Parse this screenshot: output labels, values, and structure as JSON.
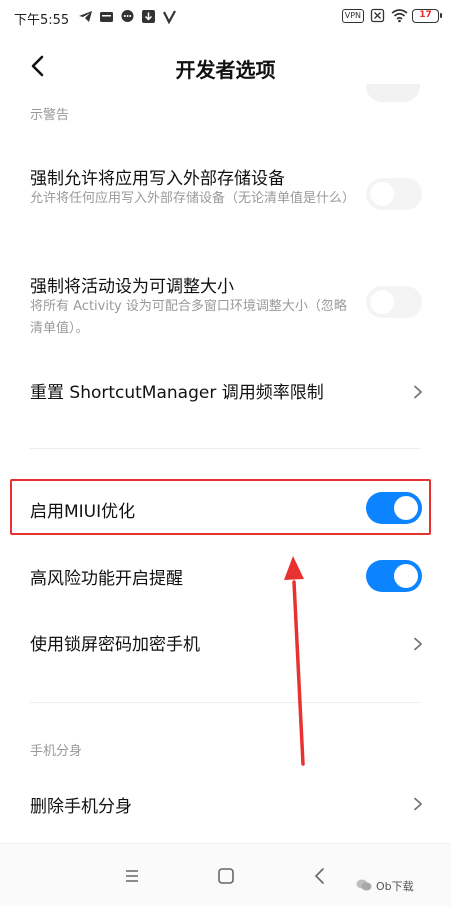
{
  "status_bar": {
    "time": "下午5:55",
    "vpn_label": "VPN",
    "battery": "17",
    "left_icons": [
      "telegram-icon",
      "notification-box-icon",
      "chat-icon",
      "download-icon",
      "v-app-icon"
    ],
    "right_icons": [
      "vpn-icon",
      "sim-icon",
      "wifi-icon",
      "battery-icon"
    ]
  },
  "header": {
    "title": "开发者选项",
    "back_icon": "back-arrow-icon"
  },
  "list": {
    "cut_text": "示警告",
    "items": [
      {
        "title": "强制允许将应用写入外部存储设备",
        "subtitle": "允许将任何应用写入外部存储设备（无论清单值是什么）",
        "toggle": false
      },
      {
        "title": "强制将活动设为可调整大小",
        "subtitle": "将所有 Activity 设为可配合多窗口环境调整大小（忽略清单值）。",
        "toggle": false
      },
      {
        "title": "重置 ShortcutManager 调用频率限制",
        "control": "chevron"
      },
      {
        "title": "启用MIUI优化",
        "toggle": true,
        "highlighted": true
      },
      {
        "title": "高风险功能开启提醒",
        "toggle": true
      },
      {
        "title": "使用锁屏密码加密手机",
        "control": "chevron"
      }
    ],
    "section_header": "手机分身",
    "section_items": [
      {
        "title": "删除手机分身",
        "control": "chevron"
      }
    ]
  },
  "annotation": {
    "highlight_color": "#e8322f",
    "arrow_color": "#e8322f"
  },
  "nav_bar": {
    "buttons": [
      "menu-icon",
      "home-icon",
      "back-icon"
    ]
  },
  "watermark": "Ob下载",
  "colors": {
    "accent": "#0d84ff",
    "toggle_off": "#f4f4f4"
  }
}
